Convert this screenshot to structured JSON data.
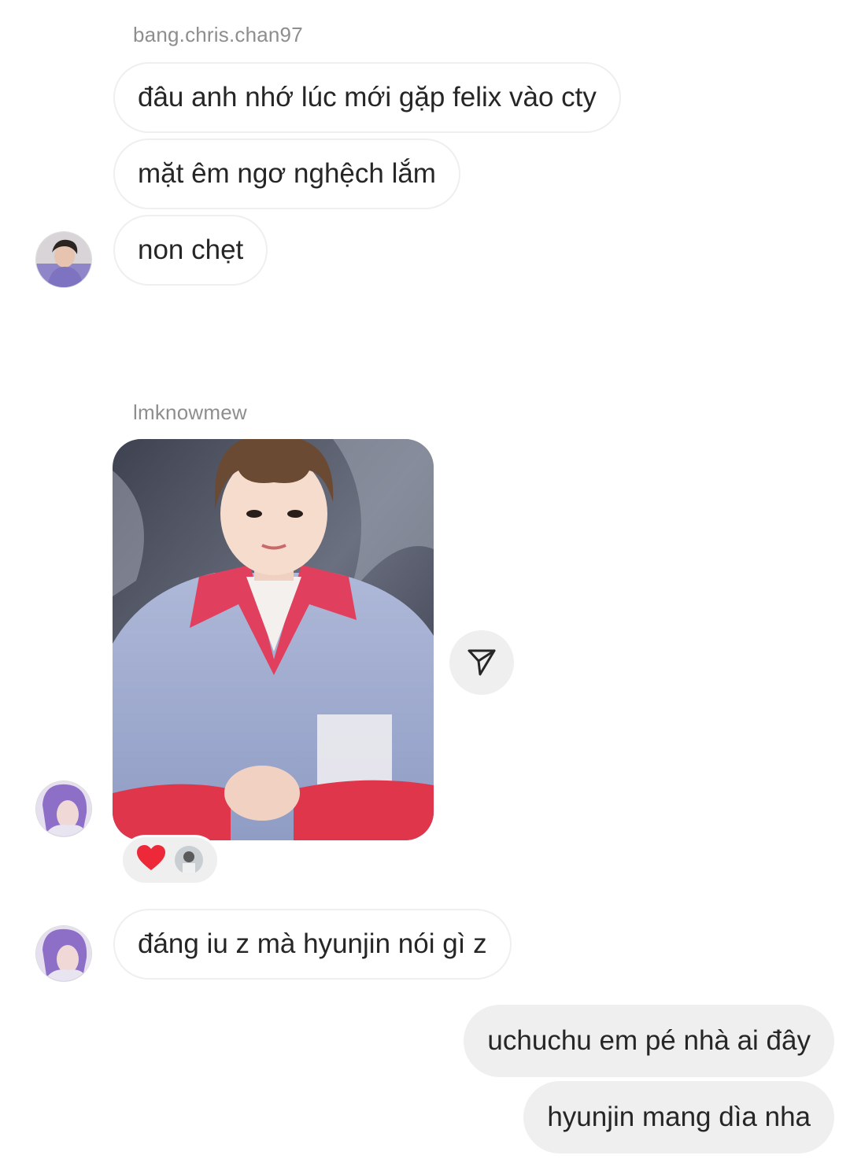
{
  "thread": {
    "group1": {
      "sender": "bang.chris.chan97",
      "messages": [
        "đâu anh nhớ lúc mới gặp felix vào cty",
        "mặt êm ngơ nghệch lắm",
        "non chẹt"
      ]
    },
    "group2": {
      "sender": "lmknowmew",
      "photo_icon": "photo-message",
      "reaction_emoji": "❤️",
      "messages": [
        "đáng iu z mà hyunjin nói gì z"
      ]
    },
    "outgoing": {
      "messages": [
        "uchuchu em pé nhà ai đây",
        "hyunjin mang dìa nha"
      ]
    }
  },
  "colors": {
    "incoming_bubble_border": "#efefef",
    "outgoing_bubble_bg": "#efefef",
    "sender_text": "#8e8e8e",
    "message_text": "#262626",
    "heart": "#ed2939"
  }
}
